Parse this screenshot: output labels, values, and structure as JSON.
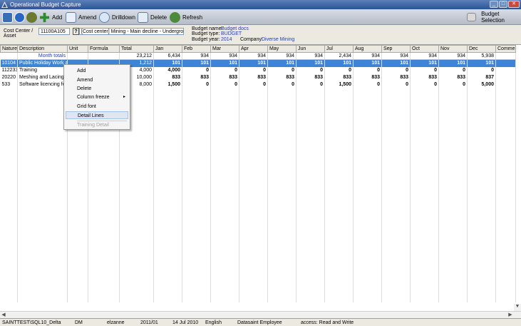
{
  "window": {
    "title": "Operational Budget Capture",
    "controls": [
      "_",
      "□",
      "✕"
    ]
  },
  "toolbar": {
    "add": "Add",
    "amend": "Amend",
    "drilldown": "Drilldown",
    "delete": "Delete",
    "refresh": "Refresh",
    "budget_selection": "Budget Selection"
  },
  "header": {
    "cost_center_label": "Cost Center /",
    "asset_label": "Asset",
    "cost_center_value": "11100A105",
    "help_glyph": "?",
    "cost_center_desc": "[Cost center]  Mining - Main decline - Underground -",
    "budget_name_label": "Budget name:",
    "budget_name_value": "Budget docs",
    "budget_type_label": "Budget type:",
    "budget_type_value": "BUDGET",
    "budget_year_label": "Budget year:",
    "budget_year_value": "2014",
    "company_label": "Company:",
    "company_value": "Diverse Mining"
  },
  "grid": {
    "columns": [
      "Nature",
      "Description",
      "Unit",
      "Formula",
      "Total",
      "Jan",
      "Feb",
      "Mar",
      "Apr",
      "May",
      "Jun",
      "Jul",
      "Aug",
      "Sep",
      "Oct",
      "Nov",
      "Dec",
      "Comment"
    ],
    "totals": {
      "label": "Month totals",
      "total": "23,212",
      "months": [
        "6,434",
        "934",
        "934",
        "934",
        "934",
        "934",
        "2,434",
        "934",
        "934",
        "934",
        "934",
        "5,938"
      ]
    },
    "rows": [
      {
        "nature": "10104",
        "description": "Public Holiday Work ag...",
        "total": "1,212",
        "months": [
          "101",
          "101",
          "101",
          "101",
          "101",
          "101",
          "101",
          "101",
          "101",
          "101",
          "101",
          "101"
        ],
        "selected": true
      },
      {
        "nature": "112233",
        "description": "Training",
        "total": "4,000",
        "months": [
          "4,000",
          "0",
          "0",
          "0",
          "0",
          "0",
          "0",
          "0",
          "0",
          "0",
          "0",
          "0"
        ],
        "selected": false
      },
      {
        "nature": "20220",
        "description": "Meshing and Lacing",
        "total": "10,000",
        "months": [
          "833",
          "833",
          "833",
          "833",
          "833",
          "833",
          "833",
          "833",
          "833",
          "833",
          "833",
          "837"
        ],
        "selected": false
      },
      {
        "nature": "533",
        "description": "Software licencing fees",
        "total": "8,000",
        "months": [
          "1,500",
          "0",
          "0",
          "0",
          "0",
          "0",
          "1,500",
          "0",
          "0",
          "0",
          "0",
          "5,000"
        ],
        "selected": false
      }
    ]
  },
  "context_menu": {
    "items": [
      "Add",
      "Amend",
      "Delete",
      "Column freeze",
      "Grid font",
      "Detail Lines",
      "Training Detail"
    ],
    "submenu_arrow": "▸"
  },
  "status_bar": {
    "server": "SAINTTEST\\SQL10_Delta",
    "code": "DM",
    "user": "elzanne",
    "period": "2011/01",
    "date": "14 Jul 2010",
    "language": "English",
    "role": "Datasaint Employee",
    "access": "access: Read and Write"
  },
  "colors": {
    "selection": "#3d83d6",
    "titlebar": "#2f5496",
    "link_blue": "#1f3fbf"
  }
}
